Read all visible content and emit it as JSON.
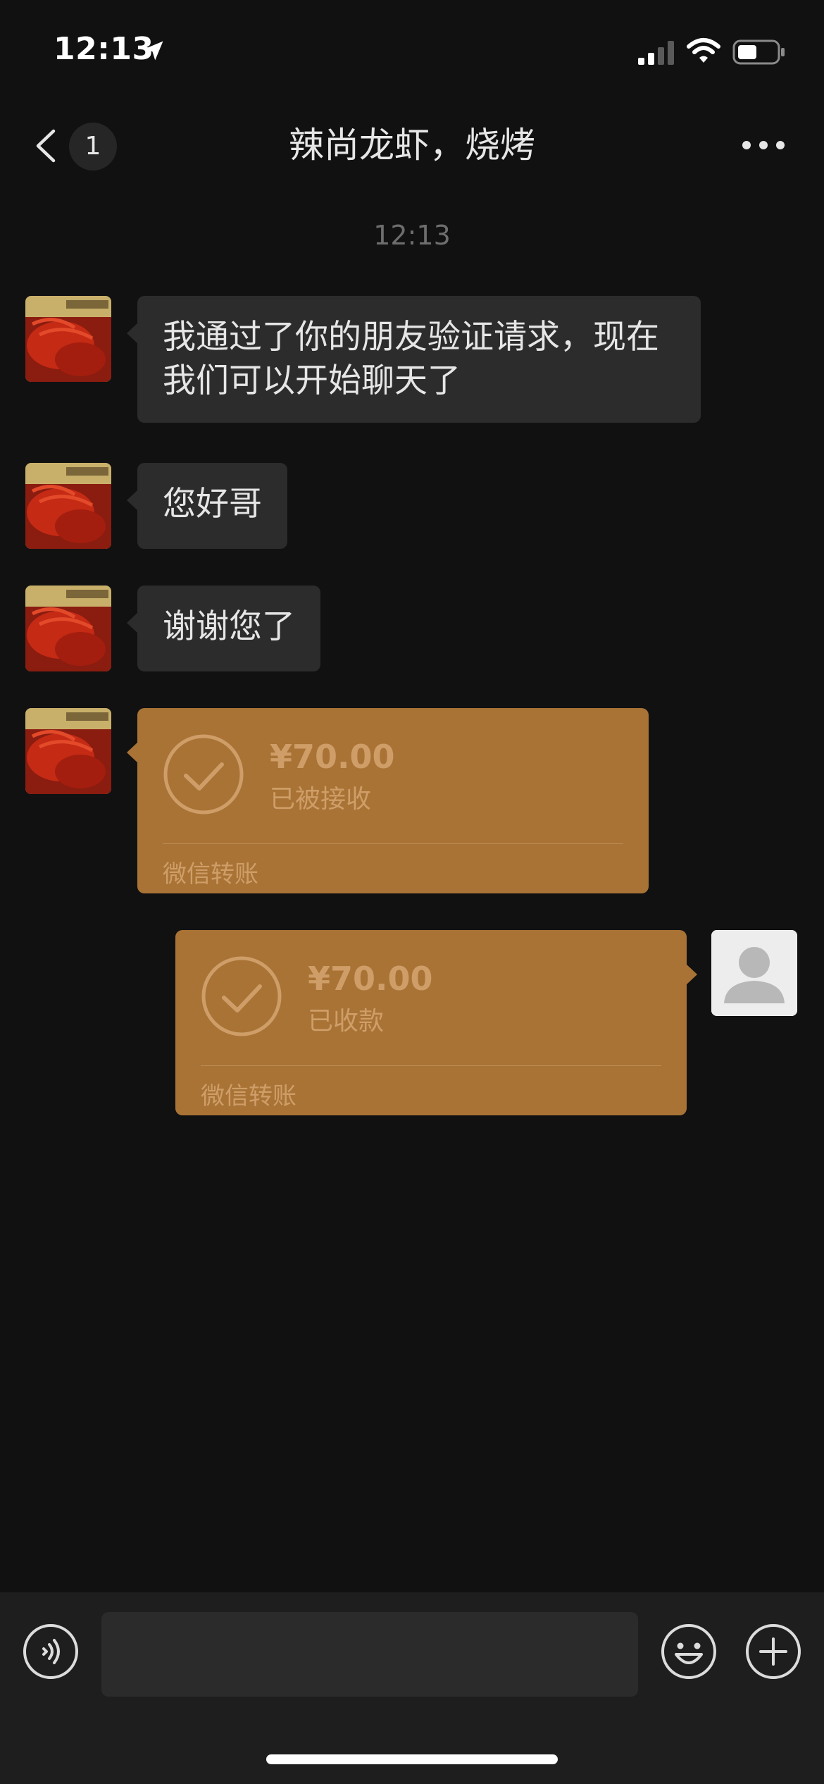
{
  "status_bar": {
    "time": "12:13",
    "icons": [
      "location-arrow-icon",
      "cellular-signal-icon",
      "wifi-icon",
      "battery-icon"
    ]
  },
  "nav": {
    "back_icon": "chevron-left-icon",
    "unread_count": "1",
    "title": "辣尚龙虾，烧烤",
    "more_icon": "more-dots-icon"
  },
  "conversation": {
    "timestamp": "12:13",
    "messages": [
      {
        "sender": "contact",
        "type": "text",
        "text": "我通过了你的朋友验证请求，现在我们可以开始聊天了"
      },
      {
        "sender": "contact",
        "type": "text",
        "text": "您好哥"
      },
      {
        "sender": "contact",
        "type": "text",
        "text": "谢谢您了"
      },
      {
        "sender": "contact",
        "type": "transfer",
        "amount": "¥70.00",
        "status": "已被接收",
        "footer": "微信转账"
      },
      {
        "sender": "self",
        "type": "transfer",
        "amount": "¥70.00",
        "status": "已收款",
        "footer": "微信转账"
      }
    ]
  },
  "input_bar": {
    "voice_icon": "voice-icon",
    "input_value": "",
    "emoji_icon": "emoji-icon",
    "plus_icon": "plus-icon"
  },
  "colors": {
    "background": "#111111",
    "bubble": "#2c2c2c",
    "transfer": "#a97336",
    "transfer_text": "#cf9e68"
  }
}
